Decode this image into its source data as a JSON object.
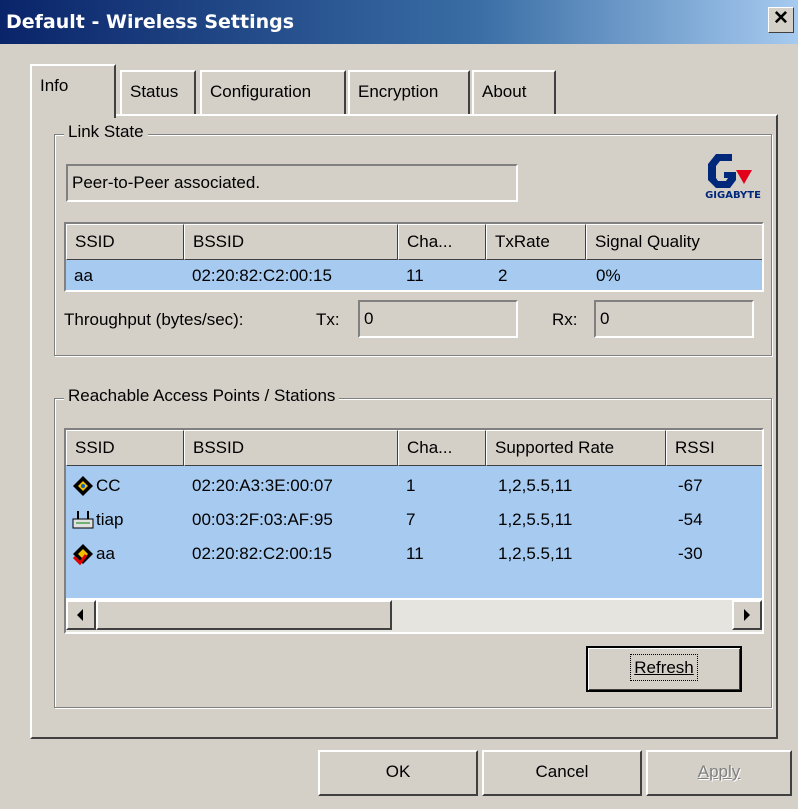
{
  "window": {
    "title": "Default - Wireless Settings"
  },
  "tabs": [
    {
      "label": "Info",
      "active": true
    },
    {
      "label": "Status"
    },
    {
      "label": "Configuration"
    },
    {
      "label": "Encryption"
    },
    {
      "label": "About"
    }
  ],
  "link_state": {
    "group_label": "Link State",
    "state_text": "Peer-to-Peer associated.",
    "logo_text": "GIGABYTE",
    "columns": [
      "SSID",
      "BSSID",
      "Cha...",
      "TxRate",
      "Signal Quality"
    ],
    "row": [
      "aa",
      "02:20:82:C2:00:15",
      "11",
      "2",
      "0%"
    ],
    "throughput_label": "Throughput (bytes/sec):",
    "tx_label": "Tx:",
    "tx_value": "0",
    "rx_label": "Rx:",
    "rx_value": "0"
  },
  "reachable": {
    "group_label": "Reachable Access Points / Stations",
    "columns": [
      "SSID",
      "BSSID",
      "Cha...",
      "Supported Rate",
      "RSSI"
    ],
    "rows": [
      {
        "icon": "adhoc-station-icon",
        "cells": [
          "CC",
          "02:20:A3:3E:00:07",
          "1",
          "1,2,5.5,11",
          "-67"
        ]
      },
      {
        "icon": "access-point-icon",
        "cells": [
          "tiap",
          "00:03:2F:03:AF:95",
          "7",
          "1,2,5.5,11",
          "-54"
        ]
      },
      {
        "icon": "connected-station-icon",
        "cells": [
          "aa",
          "02:20:82:C2:00:15",
          "11",
          "1,2,5.5,11",
          "-30"
        ]
      }
    ],
    "refresh_label": "Refresh"
  },
  "footer": {
    "ok": "OK",
    "cancel": "Cancel",
    "apply": "Apply"
  },
  "colors": {
    "selection": "#a6caf0",
    "titlebar_start": "#0a246a",
    "titlebar_end": "#a6caf0"
  }
}
